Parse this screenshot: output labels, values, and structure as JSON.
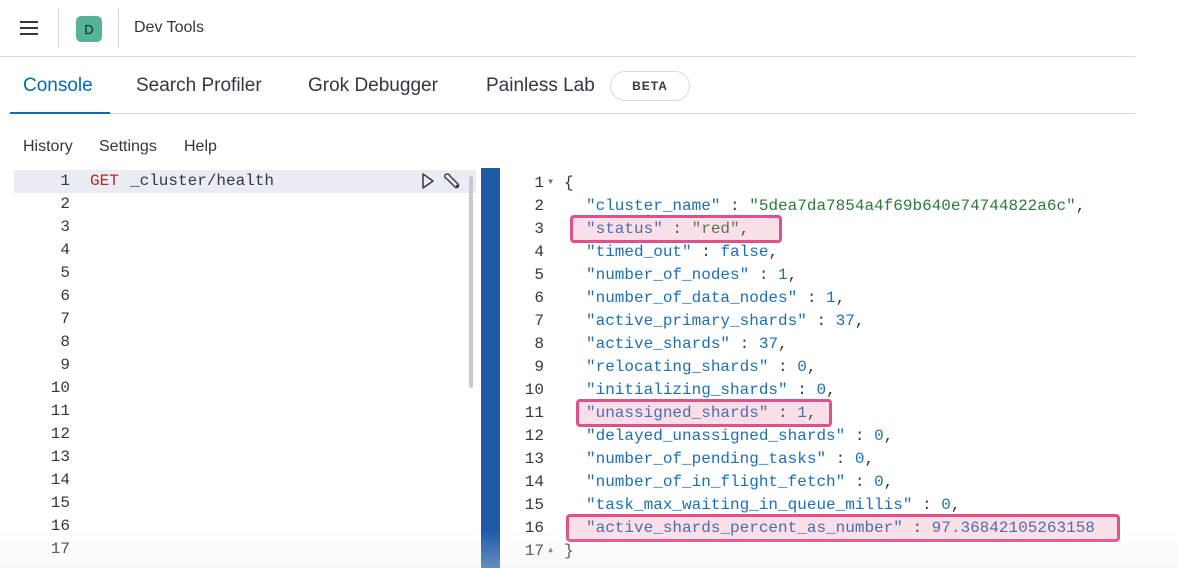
{
  "header": {
    "avatar_letter": "D",
    "title": "Dev Tools",
    "menu_icon": "hamburger-menu-icon"
  },
  "tabs": [
    {
      "label": "Console",
      "active": true
    },
    {
      "label": "Search Profiler",
      "active": false
    },
    {
      "label": "Grok Debugger",
      "active": false
    },
    {
      "label": "Painless Lab",
      "active": false
    }
  ],
  "badge": "BETA",
  "submenu": [
    "History",
    "Settings",
    "Help"
  ],
  "request": {
    "method": "GET",
    "path": "_cluster/health",
    "line_numbers": [
      "1",
      "2",
      "3",
      "4",
      "5",
      "6",
      "7",
      "8",
      "9",
      "10",
      "11",
      "12",
      "13",
      "14",
      "15",
      "16",
      "17"
    ],
    "play_icon": "play-icon",
    "wrench_icon": "wrench-icon"
  },
  "response": {
    "line_numbers": [
      "1",
      "2",
      "3",
      "4",
      "5",
      "6",
      "7",
      "8",
      "9",
      "10",
      "11",
      "12",
      "13",
      "14",
      "15",
      "16",
      "17"
    ],
    "open_brace": "{",
    "close_brace": "}",
    "fields": [
      {
        "key": "\"cluster_name\"",
        "value": "\"5dea7da7854a4f69b640e74744822a6c\"",
        "type": "string",
        "comma": ","
      },
      {
        "key": "\"status\"",
        "value": "\"red\"",
        "type": "string",
        "comma": ","
      },
      {
        "key": "\"timed_out\"",
        "value": "false",
        "type": "literal",
        "comma": ","
      },
      {
        "key": "\"number_of_nodes\"",
        "value": "1",
        "type": "number",
        "comma": ","
      },
      {
        "key": "\"number_of_data_nodes\"",
        "value": "1",
        "type": "number",
        "comma": ","
      },
      {
        "key": "\"active_primary_shards\"",
        "value": "37",
        "type": "number",
        "comma": ","
      },
      {
        "key": "\"active_shards\"",
        "value": "37",
        "type": "number",
        "comma": ","
      },
      {
        "key": "\"relocating_shards\"",
        "value": "0",
        "type": "number",
        "comma": ","
      },
      {
        "key": "\"initializing_shards\"",
        "value": "0",
        "type": "number",
        "comma": ","
      },
      {
        "key": "\"unassigned_shards\"",
        "value": "1",
        "type": "number",
        "comma": ","
      },
      {
        "key": "\"delayed_unassigned_shards\"",
        "value": "0",
        "type": "number",
        "comma": ","
      },
      {
        "key": "\"number_of_pending_tasks\"",
        "value": "0",
        "type": "number",
        "comma": ","
      },
      {
        "key": "\"number_of_in_flight_fetch\"",
        "value": "0",
        "type": "number",
        "comma": ","
      },
      {
        "key": "\"task_max_waiting_in_queue_millis\"",
        "value": "0",
        "type": "number",
        "comma": ","
      },
      {
        "key": "\"active_shards_percent_as_number\"",
        "value": "97.36842105263158",
        "type": "number",
        "comma": ""
      }
    ],
    "highlight_color": "#e0508a"
  },
  "colors": {
    "accent": "#006bb8",
    "resizer": "#1e5aa8",
    "method": "#bd271e",
    "json_key": "#1c6fb5",
    "json_string": "#2a7a3c"
  }
}
